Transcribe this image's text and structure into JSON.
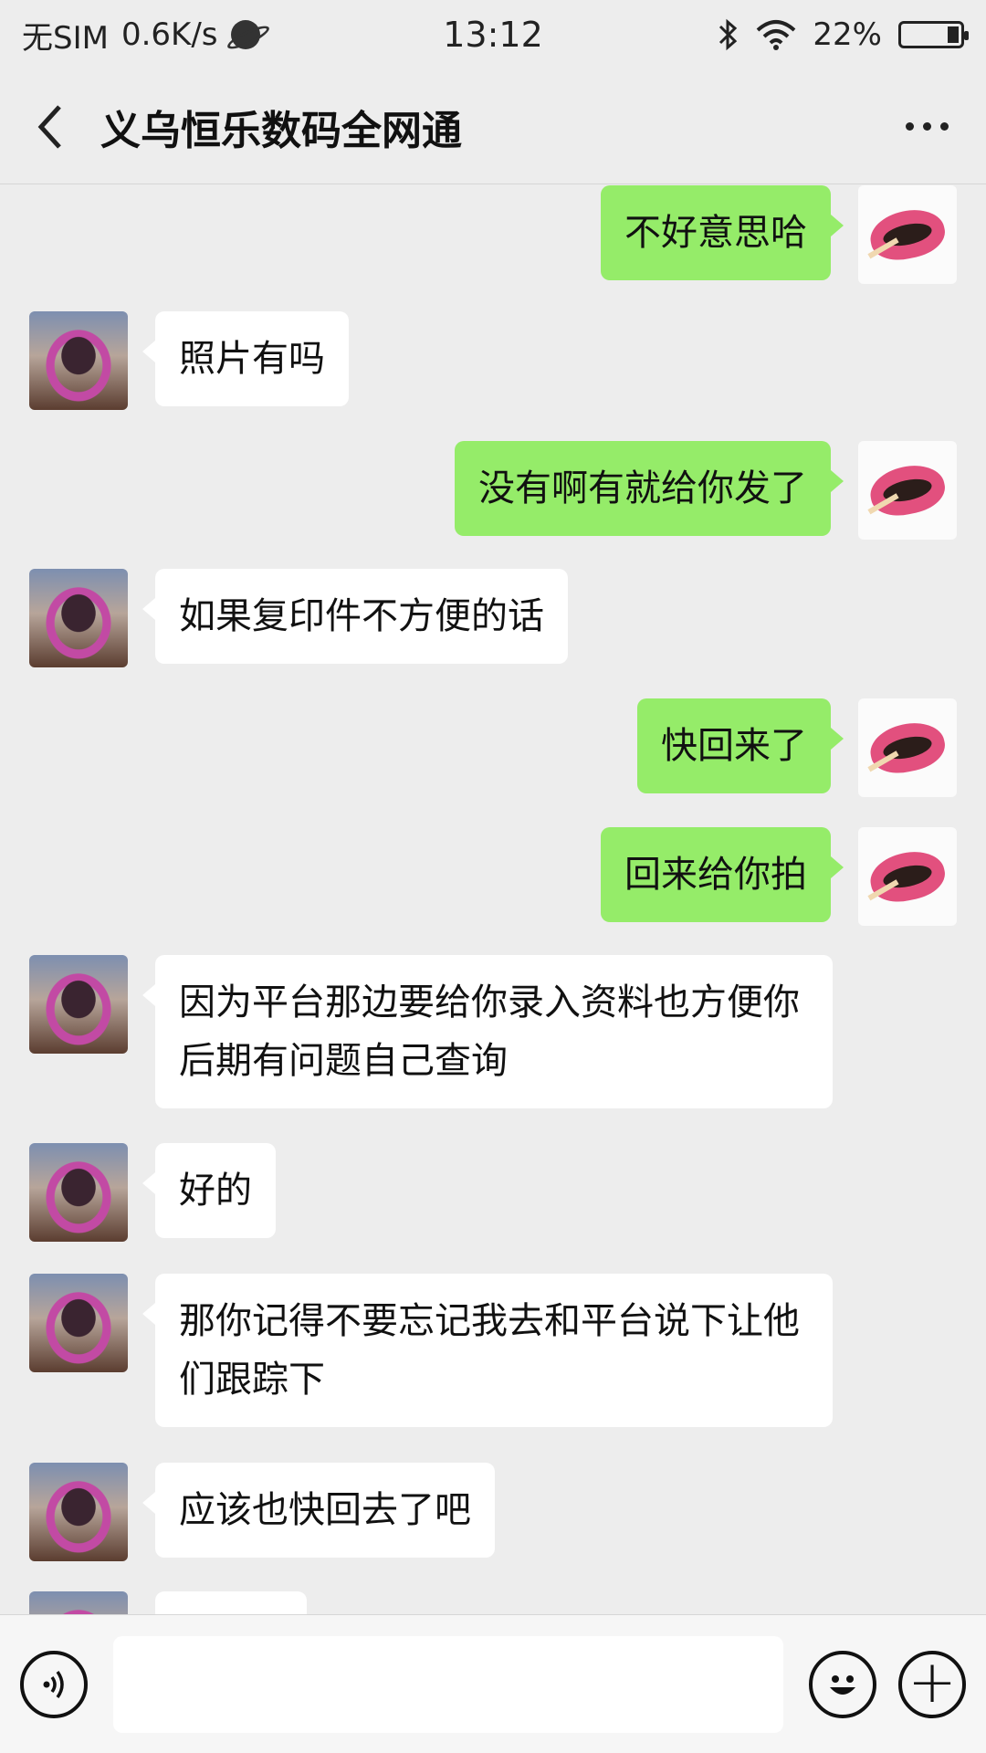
{
  "status_bar": {
    "carrier": "无SIM",
    "speed": "0.6K/s",
    "time": "13:12",
    "battery": "22%"
  },
  "header": {
    "title": "义乌恒乐数码全网通"
  },
  "messages": [
    {
      "side": "right",
      "text": "不好意思哈"
    },
    {
      "side": "left",
      "text": "照片有吗"
    },
    {
      "side": "right",
      "text": "没有啊有就给你发了"
    },
    {
      "side": "left",
      "text": "如果复印件不方便的话"
    },
    {
      "side": "right",
      "text": "快回来了"
    },
    {
      "side": "right",
      "text": "回来给你拍"
    },
    {
      "side": "left",
      "text": "因为平台那边要给你录入资料也方便你后期有问题自己查询"
    },
    {
      "side": "left",
      "text": "好的"
    },
    {
      "side": "left",
      "text": "那你记得不要忘记我去和平台说下让他们跟踪下"
    },
    {
      "side": "left",
      "text": "应该也快回去了吧"
    }
  ],
  "input_bar": {
    "voice_icon": "voice-icon",
    "emoji_icon": "emoji-icon",
    "plus_icon": "plus-icon"
  },
  "colors": {
    "background": "#ededed",
    "self_bubble": "#95ec69",
    "other_bubble": "#ffffff"
  }
}
